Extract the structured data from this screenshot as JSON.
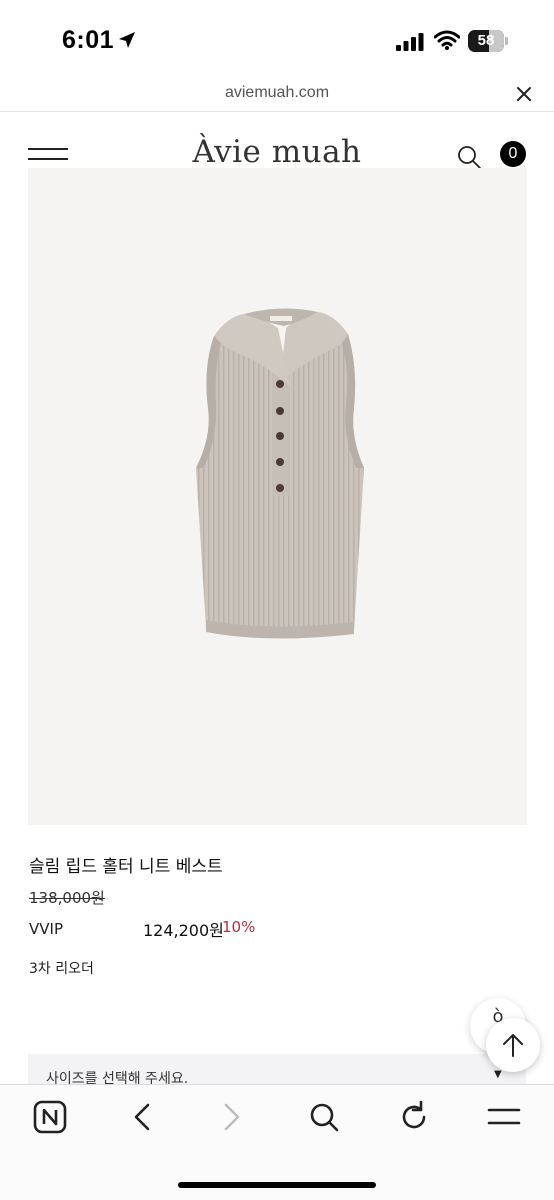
{
  "status_bar": {
    "time": "6:01",
    "battery_level": "58",
    "battery_fraction": 0.58
  },
  "browser": {
    "url": "aviemuah.com",
    "close_icon": "close-icon"
  },
  "site": {
    "logo": "Àvie muah",
    "cart_count": "0",
    "menu_icon": "hamburger-menu-icon",
    "search_icon": "search-icon"
  },
  "product": {
    "image_alt_icon": "sleeveless-ribbed-knit-vest-image",
    "name": "슬림 립드 홀터 니트 베스트",
    "original_price": "138,000원",
    "vip_label": "VVIP",
    "vip_price": "124,200원",
    "vip_discount": "10%",
    "reorder": "3차 리오더",
    "size_placeholder": "사이즈를 선택해 주세요.",
    "size_arrow": "▼"
  },
  "floating": {
    "back_glyph": "ò",
    "top_icon": "arrow-up-icon"
  },
  "toolbar": {
    "icons": [
      "naver-n-icon",
      "back-chevron-icon",
      "forward-chevron-icon",
      "search-icon",
      "refresh-icon",
      "menu-lines-icon"
    ]
  },
  "colors": {
    "discount": "#b5303c",
    "image_background": "#f5f4f2",
    "knit": "#c9c2bb"
  }
}
